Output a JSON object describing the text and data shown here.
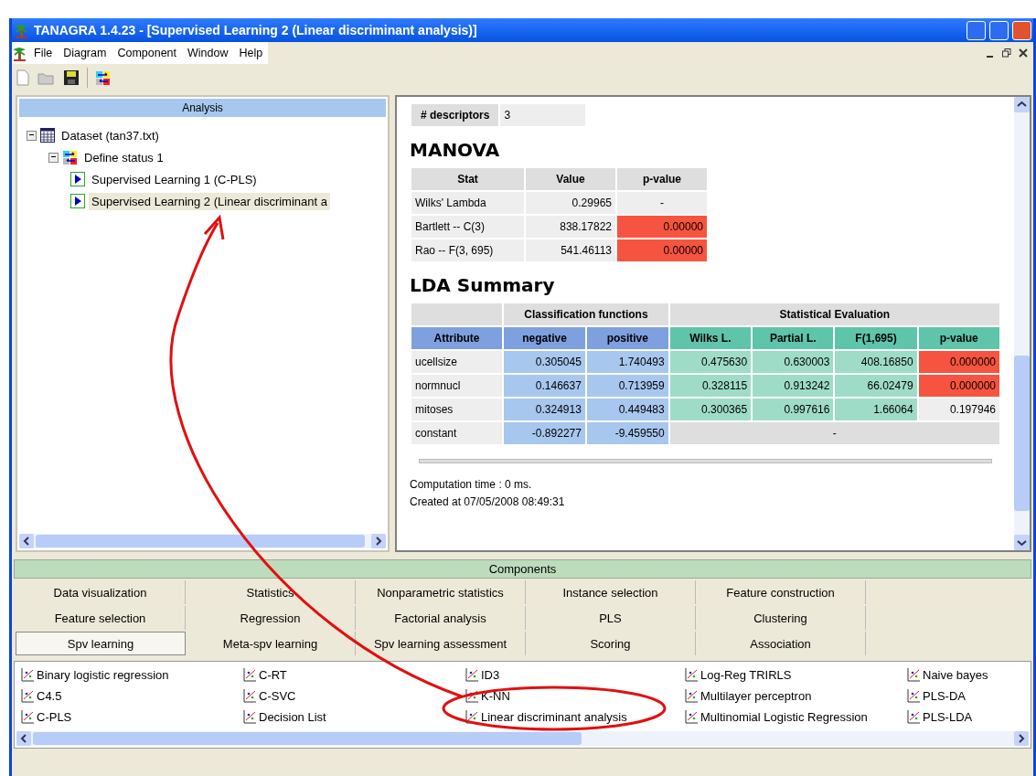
{
  "window": {
    "title": "TANAGRA 1.4.23 - [Supervised Learning 2 (Linear discriminant analysis)]"
  },
  "menu": [
    "File",
    "Diagram",
    "Component",
    "Window",
    "Help"
  ],
  "analysis": {
    "title": "Analysis",
    "tree": [
      {
        "label": "Dataset (tan37.txt)",
        "kind": "dataset",
        "expanded": true,
        "selected": false,
        "children": [
          {
            "label": "Define status 1",
            "kind": "status",
            "expanded": true,
            "selected": false,
            "children": [
              {
                "label": "Supervised Learning 1 (C-PLS)",
                "kind": "learner",
                "selected": false
              },
              {
                "label": "Supervised Learning 2 (Linear discriminant a",
                "kind": "learner",
                "selected": true
              }
            ]
          }
        ]
      }
    ]
  },
  "report": {
    "descriptors": {
      "label": "# descriptors",
      "value": "3"
    },
    "manova": {
      "title": "MANOVA",
      "columns": [
        "Stat",
        "Value",
        "p-value"
      ],
      "rows": [
        {
          "cells": [
            "Wilks' Lambda",
            "0.29965",
            "-"
          ],
          "significant": false
        },
        {
          "cells": [
            "Bartlett -- C(3)",
            "838.17822",
            "0.00000"
          ],
          "significant": true
        },
        {
          "cells": [
            "Rao -- F(3, 695)",
            "541.46113",
            "0.00000"
          ],
          "significant": true
        }
      ]
    },
    "lda": {
      "title": "LDA Summary",
      "key_column": "Attribute",
      "groups": [
        {
          "label": "Classification functions",
          "columns": [
            "negative",
            "positive"
          ]
        },
        {
          "label": "Statistical Evaluation",
          "columns": [
            "Wilks L.",
            "Partial L.",
            "F(1,695)",
            "p-value"
          ]
        }
      ],
      "rows": [
        {
          "cells": [
            "ucellsize",
            "0.305045",
            "1.740493",
            "0.475630",
            "0.630003",
            "408.16850",
            "0.000000"
          ],
          "significant": true
        },
        {
          "cells": [
            "normnucl",
            "0.146637",
            "0.713959",
            "0.328115",
            "0.913242",
            "66.02479",
            "0.000000"
          ],
          "significant": true
        },
        {
          "cells": [
            "mitoses",
            "0.324913",
            "0.449483",
            "0.300365",
            "0.997616",
            "1.66064",
            "0.197946"
          ],
          "significant": false
        },
        {
          "cells": [
            "constant",
            "-0.892277",
            "-9.459550"
          ],
          "merged": "-"
        }
      ]
    },
    "computation": "Computation time : 0 ms.",
    "created": "Created at 07/05/2008 08:49:31"
  },
  "components": {
    "title": "Components",
    "tabs": [
      {
        "label": "Data visualization",
        "selected": false
      },
      {
        "label": "Statistics",
        "selected": false
      },
      {
        "label": "Nonparametric statistics",
        "selected": false
      },
      {
        "label": "Instance selection",
        "selected": false
      },
      {
        "label": "Feature construction",
        "selected": false
      },
      {
        "label": "Feature selection",
        "selected": false
      },
      {
        "label": "Regression",
        "selected": false
      },
      {
        "label": "Factorial analysis",
        "selected": false
      },
      {
        "label": "PLS",
        "selected": false
      },
      {
        "label": "Clustering",
        "selected": false
      },
      {
        "label": "Spv learning",
        "selected": true
      },
      {
        "label": "Meta-spv learning",
        "selected": false
      },
      {
        "label": "Spv learning assessment",
        "selected": false
      },
      {
        "label": "Scoring",
        "selected": false
      },
      {
        "label": "Association",
        "selected": false
      }
    ],
    "items": [
      "Binary logistic regression",
      "C-RT",
      "ID3",
      "Log-Reg TRIRLS",
      "Naive bayes",
      "C4.5",
      "C-SVC",
      "K-NN",
      "Multilayer perceptron",
      "PLS-DA",
      "C-PLS",
      "Decision List",
      "Linear discriminant analysis",
      "Multinomial Logistic Regression",
      "PLS-LDA"
    ]
  }
}
